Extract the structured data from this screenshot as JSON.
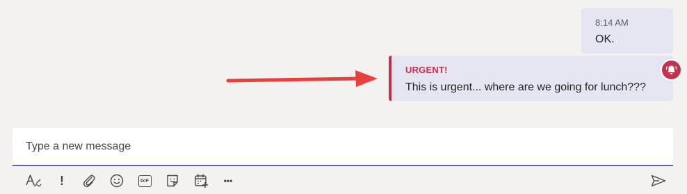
{
  "messages": [
    {
      "timestamp": "8:14 AM",
      "text": "OK."
    },
    {
      "importance_label": "URGENT!",
      "text": "This is urgent... where are we going for lunch???",
      "badge_icon": "bell-ring-icon"
    }
  ],
  "compose": {
    "placeholder": "Type a new message"
  },
  "toolbar": {
    "icons": [
      "format-icon",
      "important-icon",
      "attach-icon",
      "emoji-icon",
      "gif-icon",
      "sticker-icon",
      "schedule-meeting-icon",
      "more-options-icon"
    ],
    "gif_glyph": "GIF",
    "more_glyph": "•••",
    "important_glyph": "!",
    "send_icon": "send-icon"
  },
  "colors": {
    "background": "#f3f2f1",
    "bubble": "#e5e5f1",
    "urgent": "#c4314b",
    "accent": "#6264a7",
    "annotation_arrow": "#e8403d"
  }
}
